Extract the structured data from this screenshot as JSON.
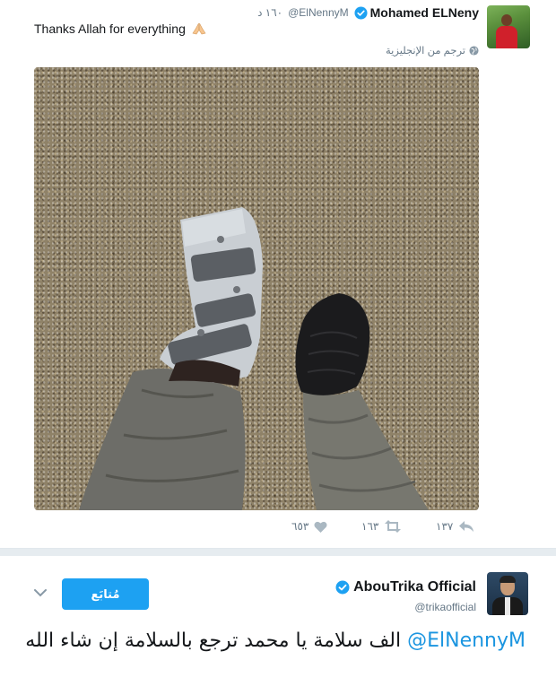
{
  "tweet1": {
    "name": "Mohamed ELNeny",
    "handle": "@ElNennyM",
    "time": "١٦٠ د",
    "text": "Thanks Allah for everything",
    "translate": "ترجم من الإنجليزية",
    "replies": "١٣٧",
    "retweets": "١٦٣",
    "likes": "٦٥٣"
  },
  "tweet2": {
    "name": "AbouTrika Official",
    "handle": "@trikaofficial",
    "follow_label": "مُتابَع",
    "mention": "@ElNennyM",
    "text": " الف سلامة يا محمد ترجع بالسلامة إن شاء الله"
  },
  "colors": {
    "accent": "#1da1f2",
    "verified": "#1da1f2",
    "muted": "#657786"
  },
  "icons": [
    "verified-badge-icon",
    "folded-hands-emoji-icon",
    "globe-icon",
    "reply-icon",
    "retweet-icon",
    "heart-icon",
    "chevron-down-icon"
  ]
}
